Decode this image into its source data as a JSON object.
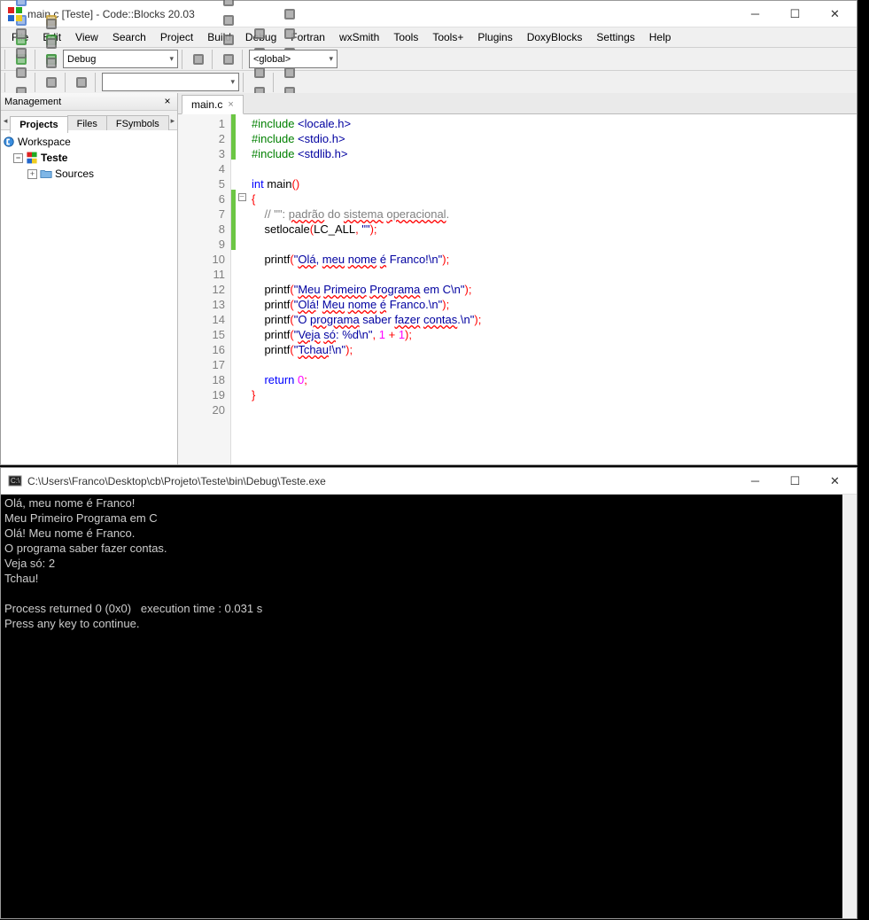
{
  "main_window": {
    "title": "main.c [Teste] - Code::Blocks 20.03",
    "menu": [
      "File",
      "Edit",
      "View",
      "Search",
      "Project",
      "Build",
      "Debug",
      "Fortran",
      "wxSmith",
      "Tools",
      "Tools+",
      "Plugins",
      "DoxyBlocks",
      "Settings",
      "Help"
    ],
    "build_target": "Debug",
    "scope_combo": "<global>",
    "search_combo": ""
  },
  "management": {
    "title": "Management",
    "tabs": [
      "Projects",
      "Files",
      "FSymbols"
    ],
    "active_tab": 0,
    "tree": {
      "workspace": "Workspace",
      "project": "Teste",
      "folder": "Sources"
    }
  },
  "editor": {
    "tab_label": "main.c",
    "lines": [
      {
        "n": 1,
        "mod": true,
        "html": "<span class='pp'>#include </span><span class='ppinc'>&lt;locale.h&gt;</span>"
      },
      {
        "n": 2,
        "mod": true,
        "html": "<span class='pp'>#include </span><span class='ppinc'>&lt;stdio.h&gt;</span>"
      },
      {
        "n": 3,
        "mod": true,
        "html": "<span class='pp'>#include </span><span class='ppinc'>&lt;stdlib.h&gt;</span>"
      },
      {
        "n": 4,
        "mod": false,
        "html": ""
      },
      {
        "n": 5,
        "mod": false,
        "html": "<span class='kw'>int</span> main<span class='op'>()</span>"
      },
      {
        "n": 6,
        "mod": true,
        "fold": true,
        "html": "<span class='op'>{</span>"
      },
      {
        "n": 7,
        "mod": true,
        "html": "    <span class='cmt'>// \"\": <span class='uw'>padrão</span> do <span class='uw'>sistema</span> <span class='uw'>operacional</span>.</span>"
      },
      {
        "n": 8,
        "mod": true,
        "html": "    setlocale<span class='op'>(</span>LC_ALL<span class='op'>,</span> <span class='str'>\"\"</span><span class='op'>);</span>"
      },
      {
        "n": 9,
        "mod": true,
        "html": ""
      },
      {
        "n": 10,
        "mod": false,
        "html": "    printf<span class='op'>(</span><span class='str'>\"<span class='uw'>Olá</span>, <span class='uw'>meu</span> <span class='uw'>nome</span> <span class='uw'>é</span> Franco!\\n\"</span><span class='op'>);</span>"
      },
      {
        "n": 11,
        "mod": false,
        "html": ""
      },
      {
        "n": 12,
        "mod": false,
        "html": "    printf<span class='op'>(</span><span class='str'>\"<span class='uw'>Meu</span> <span class='uw'>Primeiro</span> <span class='uw'>Programa</span> em C\\n\"</span><span class='op'>);</span>"
      },
      {
        "n": 13,
        "mod": false,
        "html": "    printf<span class='op'>(</span><span class='str'>\"<span class='uw'>Olá</span>! <span class='uw'>Meu</span> <span class='uw'>nome</span> <span class='uw'>é</span> Franco.\\n\"</span><span class='op'>);</span>"
      },
      {
        "n": 14,
        "mod": false,
        "html": "    printf<span class='op'>(</span><span class='str'>\"O <span class='uw'>programa</span> saber <span class='uw'>fazer</span> <span class='uw'>contas</span>.\\n\"</span><span class='op'>);</span>"
      },
      {
        "n": 15,
        "mod": false,
        "html": "    printf<span class='op'>(</span><span class='str'>\"<span class='uw'>Veja</span> <span class='uw'>só</span>: %d\\n\"</span><span class='op'>,</span> <span class='num'>1</span> <span class='op'>+</span> <span class='num'>1</span><span class='op'>);</span>"
      },
      {
        "n": 16,
        "mod": false,
        "html": "    printf<span class='op'>(</span><span class='str'>\"<span class='uw'>Tchau</span>!\\n\"</span><span class='op'>);</span>"
      },
      {
        "n": 17,
        "mod": false,
        "html": ""
      },
      {
        "n": 18,
        "mod": false,
        "html": "    <span class='kw'>return</span> <span class='num'>0</span><span class='op'>;</span>"
      },
      {
        "n": 19,
        "mod": false,
        "html": "<span class='op'>}</span>"
      },
      {
        "n": 20,
        "mod": false,
        "html": ""
      }
    ]
  },
  "console_window": {
    "title": "C:\\Users\\Franco\\Desktop\\cb\\Projeto\\Teste\\bin\\Debug\\Teste.exe",
    "output": "Olá, meu nome é Franco!\nMeu Primeiro Programa em C\nOlá! Meu nome é Franco.\nO programa saber fazer contas.\nVeja só: 2\nTchau!\n\nProcess returned 0 (0x0)   execution time : 0.031 s\nPress any key to continue."
  },
  "toolbar1_icons": [
    "new-file",
    "open-file",
    "save-file",
    "save-all",
    "undo",
    "redo",
    "cut",
    "copy",
    "paste",
    "find",
    "find-replace"
  ],
  "toolbar1b_icons": [
    "build",
    "run",
    "build-run",
    "rebuild",
    "abort"
  ],
  "toolbar1c_icons": [
    "show-target"
  ],
  "toolbar1d_icons": [
    "debug-start",
    "run-to-cursor",
    "next-line",
    "step-into",
    "step-out",
    "next-instr",
    "step-instr",
    "break",
    "stop",
    "debug-windows",
    "info"
  ],
  "toolbar2_icons": [
    "nav-back",
    "nav-fwd",
    "bookmark-toggle",
    "bookmark-prev",
    "bookmark-next",
    "bookmark-clear"
  ],
  "toolbar2b_icons": [
    "intellisense",
    "refresh",
    "comment-block",
    "doxy",
    "preview",
    "wand",
    "help"
  ],
  "toolbar2c_icons": [
    "jump-back",
    "jump-line",
    "jump-fwd"
  ],
  "toolbar2d_icons": [
    "sel-back",
    "sel-fwd",
    "highlight",
    "goto-file",
    "match-case",
    "regex"
  ],
  "toolbar2e_icons": [
    "cursor",
    "win1",
    "win2",
    "win3",
    "win4",
    "win5",
    "win6",
    "win7"
  ]
}
